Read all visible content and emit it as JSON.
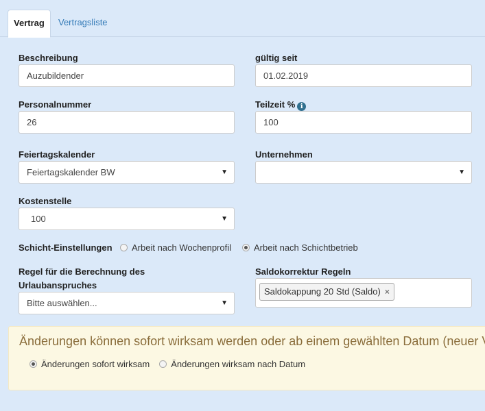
{
  "tabs": [
    {
      "label": "Vertrag",
      "active": true
    },
    {
      "label": "Vertragsliste",
      "active": false
    }
  ],
  "form": {
    "beschreibung": {
      "label": "Beschreibung",
      "value": "Auzubildender"
    },
    "gueltig_seit": {
      "label": "gültig seit",
      "value": "01.02.2019"
    },
    "personalnummer": {
      "label": "Personalnummer",
      "value": "26"
    },
    "teilzeit": {
      "label": "Teilzeit %",
      "value": "100",
      "icon": "info-icon"
    },
    "feiertagskalender": {
      "label": "Feiertagskalender",
      "value": "Feiertagskalender BW"
    },
    "unternehmen": {
      "label": "Unternehmen",
      "value": ""
    },
    "kostenstelle": {
      "label": "Kostenstelle",
      "value": "100"
    },
    "schicht": {
      "label": "Schicht-Einstellungen",
      "options": [
        {
          "label": "Arbeit nach Wochenprofil",
          "checked": false
        },
        {
          "label": "Arbeit nach Schichtbetrieb",
          "checked": true
        }
      ]
    },
    "urlaubsregel": {
      "label_line1": "Regel für die Berechnung des",
      "label_line2": "Urlaubanspruches",
      "value": "Bitte auswählen..."
    },
    "saldokorrektur": {
      "label": "Saldokorrektur Regeln",
      "tags": [
        "Saldokappung 20 Std (Saldo)"
      ],
      "remove_glyph": "×"
    }
  },
  "notice": {
    "title": "Änderungen können sofort wirksam werden oder ab einem gewählten Datum (neuer Ve",
    "options": [
      {
        "label": "Änderungen sofort wirksam",
        "checked": true
      },
      {
        "label": "Änderungen wirksam nach Datum",
        "checked": false
      }
    ]
  },
  "caret_glyph": "▼"
}
